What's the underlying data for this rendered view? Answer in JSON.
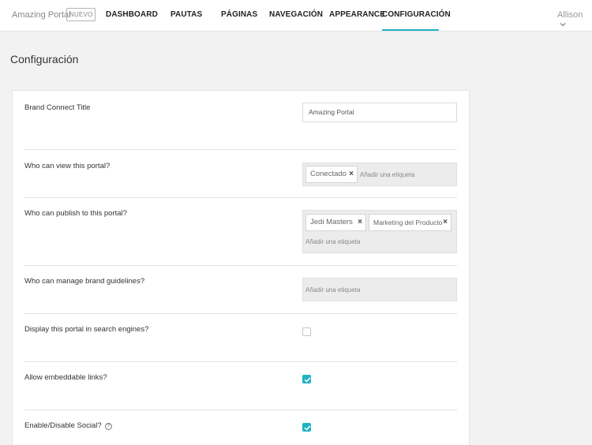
{
  "header": {
    "brand": "Amazing Portal",
    "badge": "NUEVO",
    "nav": [
      {
        "label": "DASHBOARD"
      },
      {
        "label": "PAUTAS"
      },
      {
        "label": "PÁGINAS"
      },
      {
        "label": "NAVEGACIÓN"
      },
      {
        "label": "APPEARANCE"
      },
      {
        "label": "CONFIGURACIÓN",
        "active": true
      }
    ],
    "user": "Allison",
    "user_icon": "chevron-down-icon"
  },
  "page": {
    "title": "Configuración"
  },
  "settings": {
    "brand_connect_title": {
      "label": "Brand Connect Title",
      "value": "Amazing Portal"
    },
    "who_can_view": {
      "label": "Who can view this portal?",
      "tags": [
        "Conectado"
      ],
      "placeholder": "Añadir una etiqueta"
    },
    "who_can_publish": {
      "label": "Who can publish to this portal?",
      "tags": [
        "Jedi Masters",
        "Marketing del Producto"
      ],
      "placeholder": "Añadir una etiqueta"
    },
    "who_can_manage": {
      "label": "Who can manage brand guidelines?",
      "placeholder": "Añadir una etiqueta"
    },
    "search_engines": {
      "label": "Display this portal in search engines?",
      "checked": false
    },
    "embeddable_links": {
      "label": "Allow embeddable links?",
      "checked": true
    },
    "social": {
      "label": "Enable/Disable Social?",
      "checked": true,
      "help_icon": "?"
    }
  },
  "colors": {
    "accent": "#1fb3c3",
    "background": "#f2f2f2"
  }
}
